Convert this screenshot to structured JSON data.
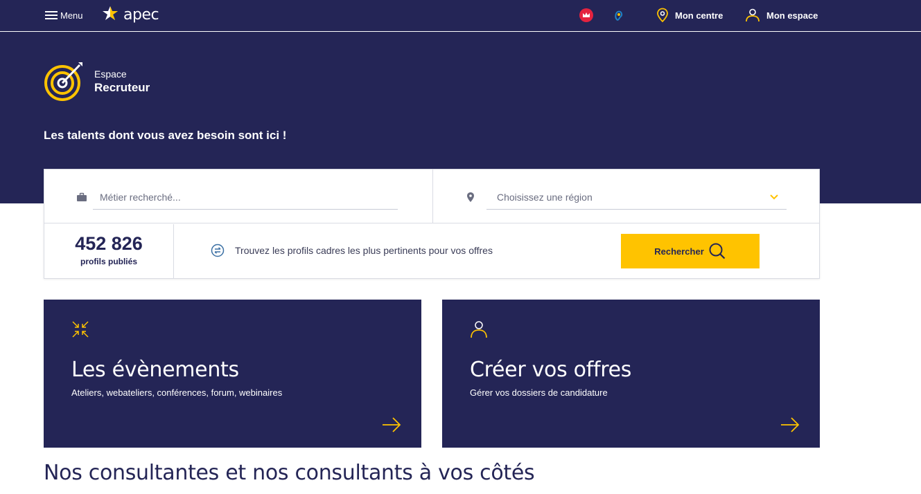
{
  "header": {
    "menu_label": "Menu",
    "logo_text": "apec",
    "accessibility": [
      {
        "icon": "crown-accessibility-icon"
      },
      {
        "icon": "ear-accessibility-icon"
      }
    ],
    "mon_centre": "Mon centre",
    "mon_espace": "Mon espace"
  },
  "hero": {
    "espace_small": "Espace",
    "espace_big": "Recruteur",
    "tagline": "Les talents dont vous avez besoin sont ici !"
  },
  "search": {
    "metier_placeholder": "Métier recherché...",
    "region_value": "Choisissez une région",
    "profiles_count": "452 826",
    "profiles_label": "profils publiés",
    "info_text": "Trouvez les profils cadres les plus pertinents pour vos offres",
    "button_label": "Rechercher"
  },
  "cards": [
    {
      "title": "Les évènements",
      "subtitle": "Ateliers, webateliers, conférences, forum, webinaires",
      "icon": "arrows-inward-icon"
    },
    {
      "title": "Créer vos offres",
      "subtitle": "Gérer vos dossiers de candidature",
      "icon": "user-icon"
    }
  ],
  "section": {
    "title": "Nos consultantes et nos consultants à vos côtés"
  },
  "colors": {
    "navy": "#242556",
    "accent_yellow": "#ffc300",
    "white": "#ffffff"
  }
}
